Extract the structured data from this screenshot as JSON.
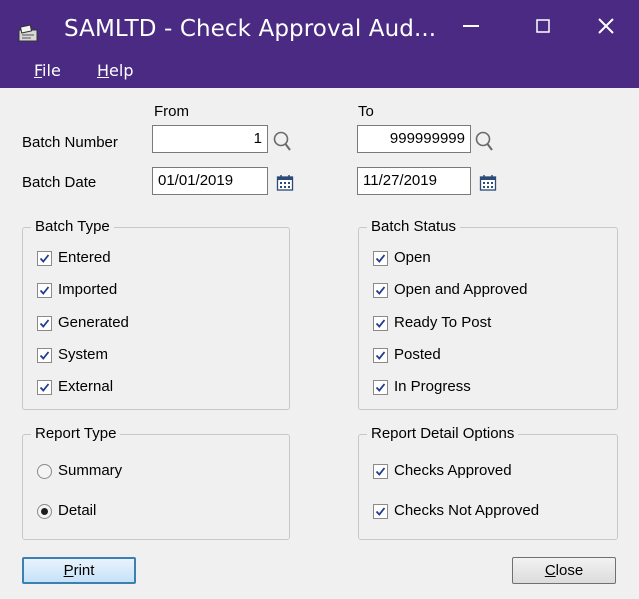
{
  "window": {
    "title": "SAMLTD - Check Approval Aud...",
    "controls": {
      "minimize_icon": "minimize-icon",
      "maximize_icon": "maximize-icon",
      "close_icon": "close-icon"
    }
  },
  "menu": {
    "items": [
      {
        "first": "F",
        "rest": "ile"
      },
      {
        "first": "H",
        "rest": "elp"
      }
    ]
  },
  "range": {
    "from_header": "From",
    "to_header": "To",
    "batch_number": {
      "label": "Batch Number",
      "from": "1",
      "to": "999999999"
    },
    "batch_date": {
      "label": "Batch Date",
      "from": "01/01/2019",
      "to": "11/27/2019"
    }
  },
  "batch_type": {
    "title": "Batch Type",
    "items": [
      {
        "label": "Entered",
        "checked": true
      },
      {
        "label": "Imported",
        "checked": true
      },
      {
        "label": "Generated",
        "checked": true
      },
      {
        "label": "System",
        "checked": true
      },
      {
        "label": "External",
        "checked": true
      }
    ]
  },
  "batch_status": {
    "title": "Batch Status",
    "items": [
      {
        "label": "Open",
        "checked": true
      },
      {
        "label": "Open and Approved",
        "checked": true
      },
      {
        "label": "Ready To Post",
        "checked": true
      },
      {
        "label": "Posted",
        "checked": true
      },
      {
        "label": "In Progress",
        "checked": true
      }
    ]
  },
  "report_type": {
    "title": "Report Type",
    "options": [
      {
        "label": "Summary",
        "selected": false
      },
      {
        "label": "Detail",
        "selected": true
      }
    ]
  },
  "report_detail": {
    "title": "Report Detail Options",
    "items": [
      {
        "label": "Checks Approved",
        "checked": true
      },
      {
        "label": "Checks Not Approved",
        "checked": true
      }
    ]
  },
  "buttons": {
    "print": {
      "first": "P",
      "rest": "rint"
    },
    "close": {
      "first": "C",
      "rest": "lose"
    }
  },
  "colors": {
    "titlebar": "#4a2a82",
    "window_bg": "#f0f0f0",
    "check": "#1f3f8f"
  }
}
